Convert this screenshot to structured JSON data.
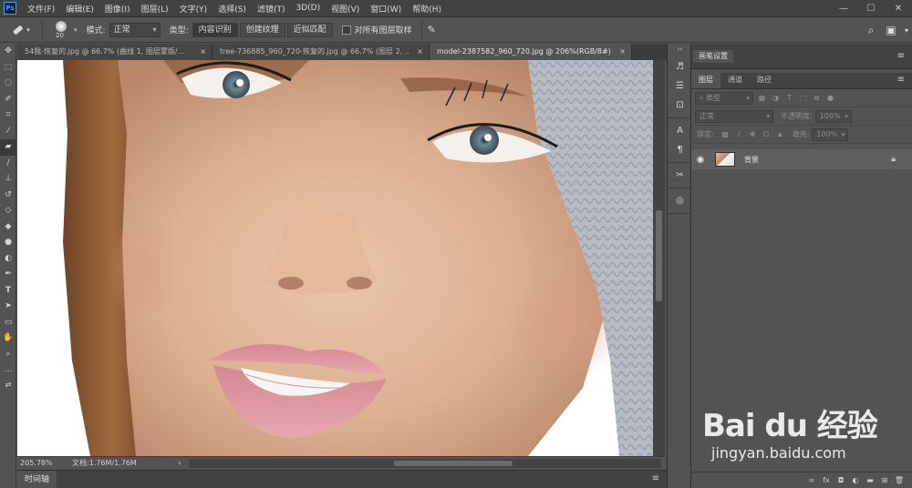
{
  "app": {
    "logo_text": "Ps"
  },
  "menu": [
    "文件(F)",
    "编辑(E)",
    "图像(I)",
    "图层(L)",
    "文字(Y)",
    "选择(S)",
    "滤镜(T)",
    "3D(D)",
    "视图(V)",
    "窗口(W)",
    "帮助(H)"
  ],
  "window_controls": {
    "minimize": "—",
    "maximize": "☐",
    "close": "✕"
  },
  "options": {
    "brush_size": "20",
    "mode_label": "模式:",
    "mode_value": "正常",
    "type_label": "类型:",
    "type_buttons": [
      "内容识别",
      "创建纹理",
      "近似匹配"
    ],
    "active_type": 0,
    "sample_all_label": "对所有图层取样"
  },
  "tabs": [
    {
      "title": "54我-恢复的.jpg @ 66.7% (曲线 1, 图层蒙版/...",
      "close": "×"
    },
    {
      "title": "tree-736885_960_720-恢复的.jpg @ 66.7% (图层 2, ...",
      "close": "×"
    },
    {
      "title": "model-2387582_960_720.jpg @ 206%(RGB/8#) *",
      "close": "×",
      "active": true
    }
  ],
  "status": {
    "zoom": "205.78%",
    "doc_info": "文档:1.76M/1.76M",
    "arrow": "›"
  },
  "timeline": {
    "label": "时间轴",
    "menu": "≡"
  },
  "panels": {
    "top_title": "画笔设置",
    "top_menu": "≡",
    "tabs": [
      "图层",
      "通道",
      "路径"
    ],
    "active_tab": 0,
    "tab_menu": "≡",
    "filter_kind": "类型",
    "blend_mode": "正常",
    "opacity_label": "不透明度:",
    "opacity_value": "100%",
    "lock_label": "锁定:",
    "fill_label": "填充:",
    "fill_value": "100%",
    "layer_name": "背景"
  },
  "watermark": {
    "brand": "Bai du 经验",
    "url": "jingyan.baidu.com"
  },
  "colors": {
    "foreground": "#c4161c",
    "background": "#1d9a5b",
    "accent": "#31a8ff"
  }
}
